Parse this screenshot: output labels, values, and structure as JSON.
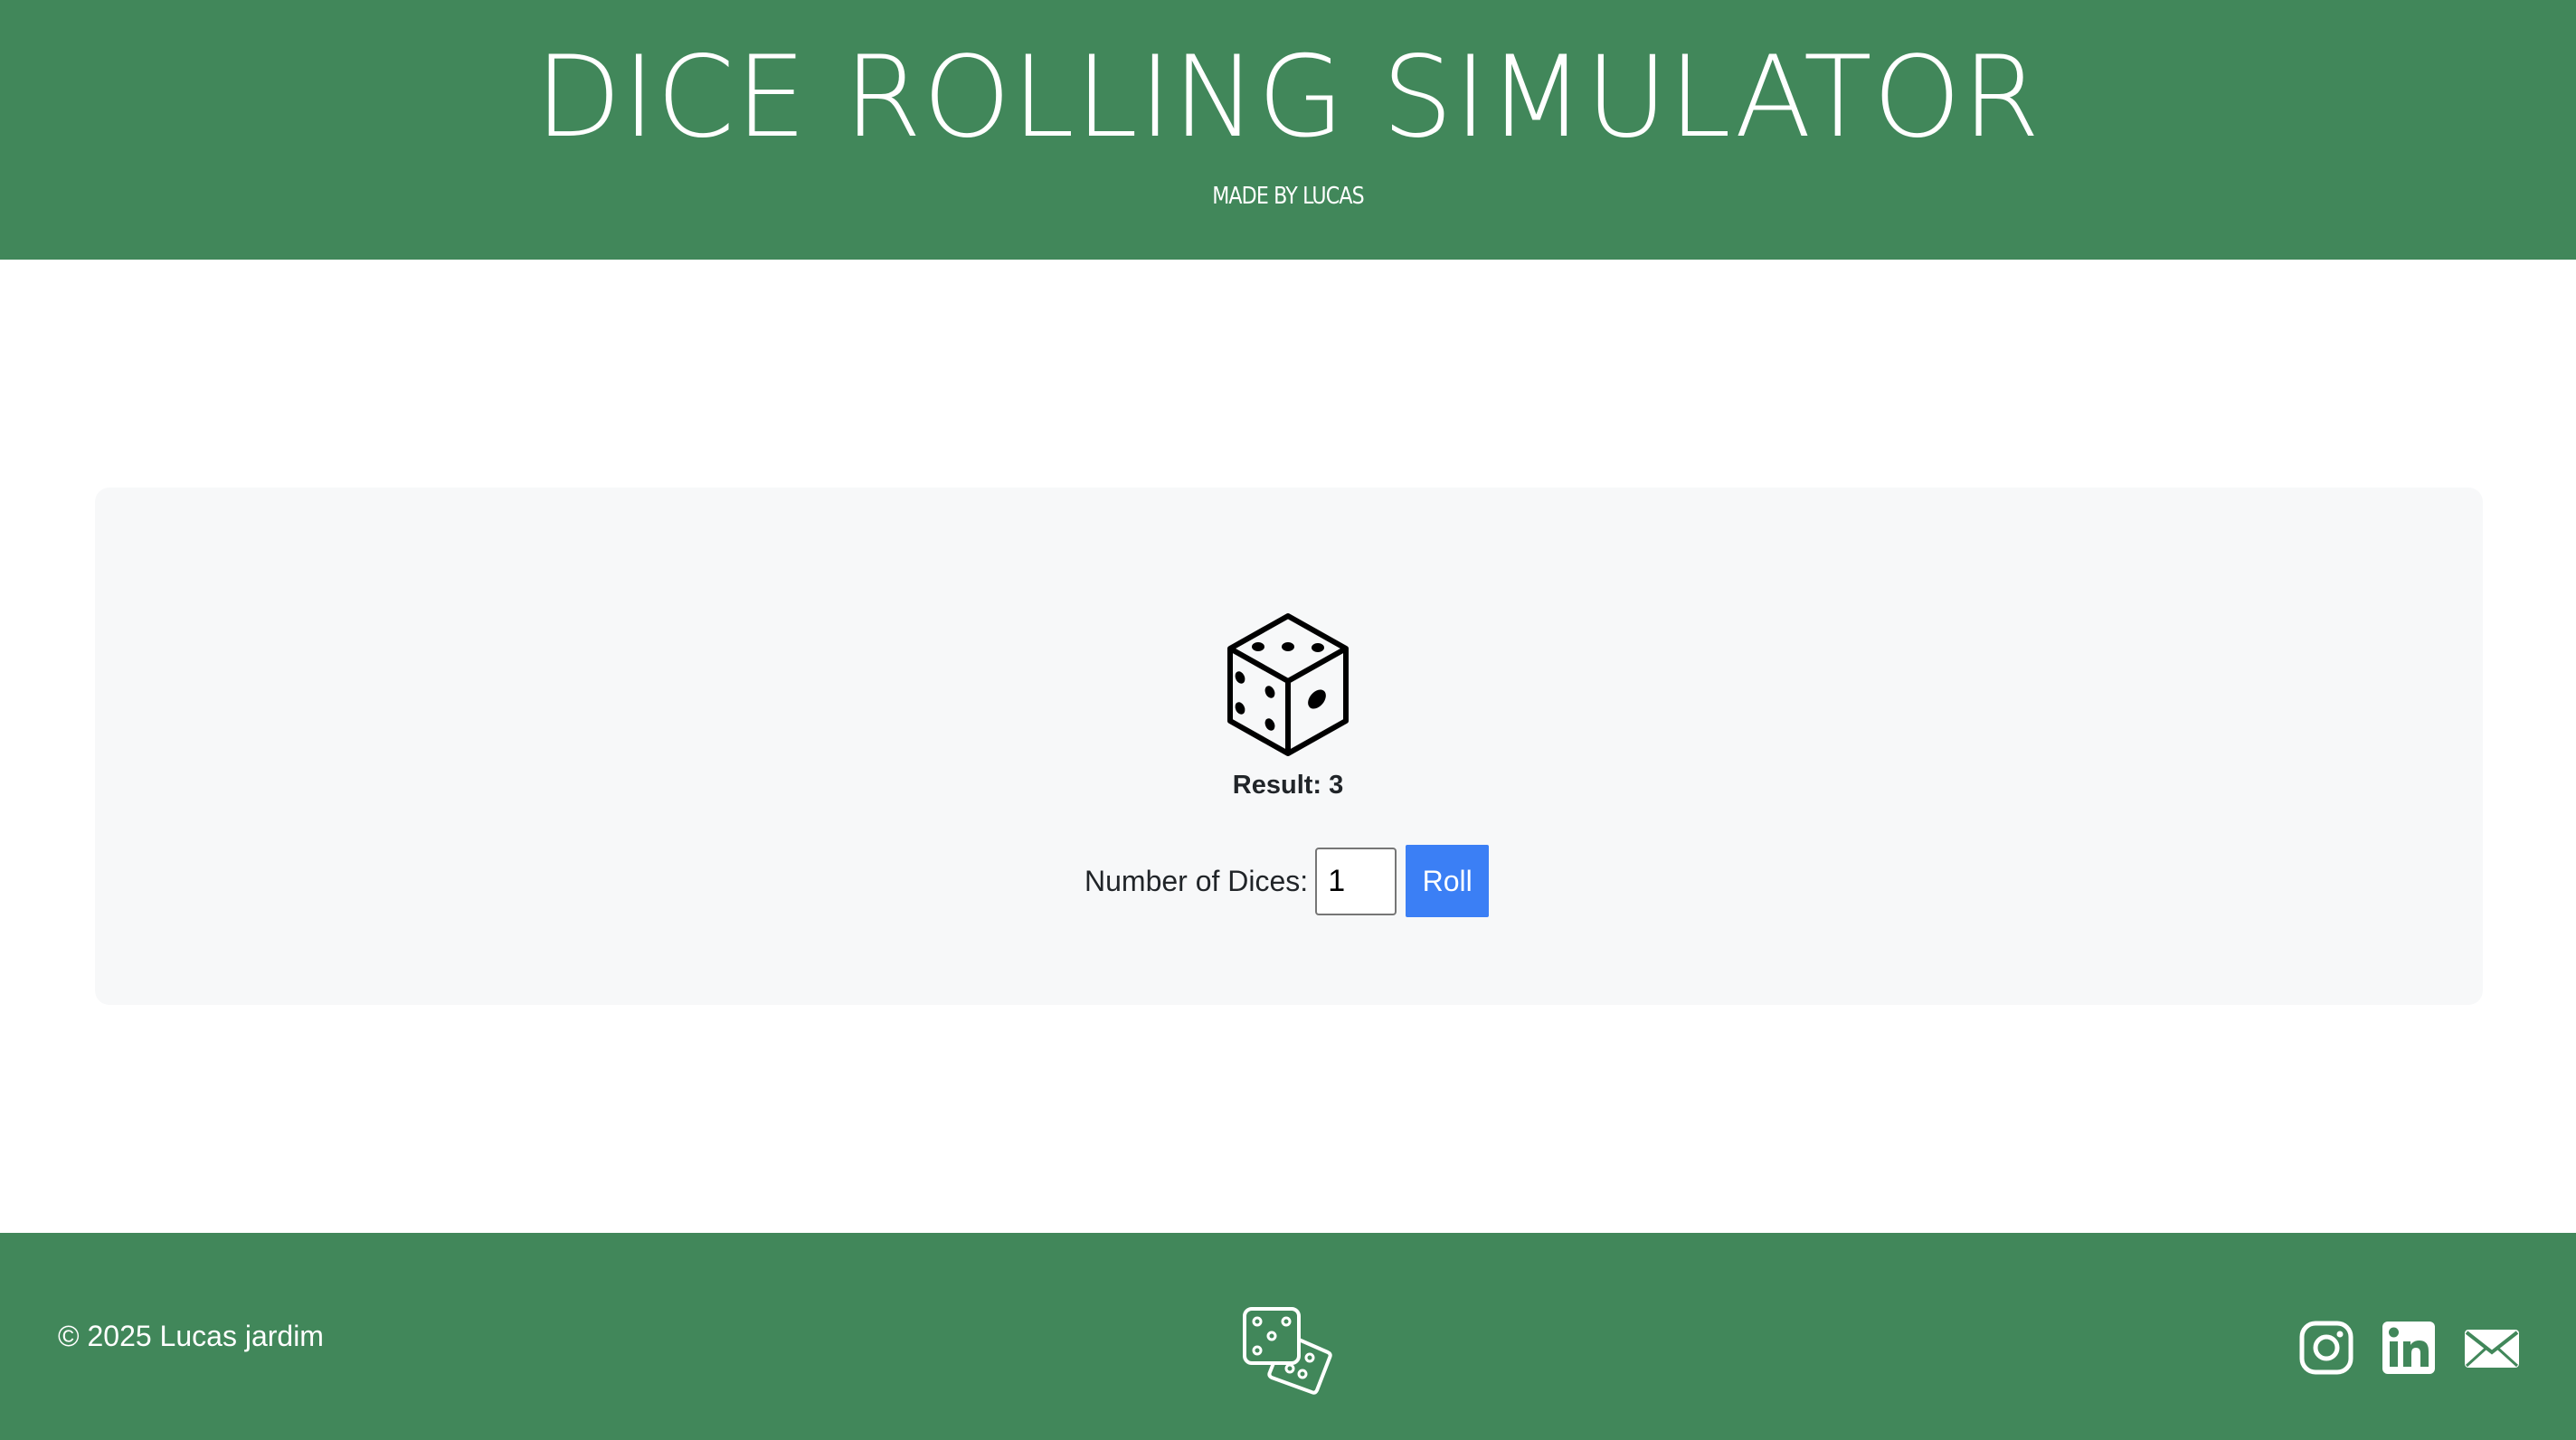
{
  "header": {
    "title": "DICE ROLLING SIMULATOR",
    "subtitle": "MADE BY LUCAS"
  },
  "main": {
    "die_icon": "dice-three-icon",
    "result_label": "Result:",
    "result_value": "3",
    "dice_count_label": "Number of Dices:",
    "dice_count_value": "1",
    "roll_button": "Roll"
  },
  "footer": {
    "copyright": "© 2025 Lucas jardim",
    "logo_icon": "dice-pair-icon",
    "social": [
      "instagram-icon",
      "linkedin-icon",
      "mail-icon"
    ]
  },
  "colors": {
    "brand_green": "#41875a",
    "card_bg": "#f7f8f9",
    "button_blue": "#3b7ff5"
  }
}
